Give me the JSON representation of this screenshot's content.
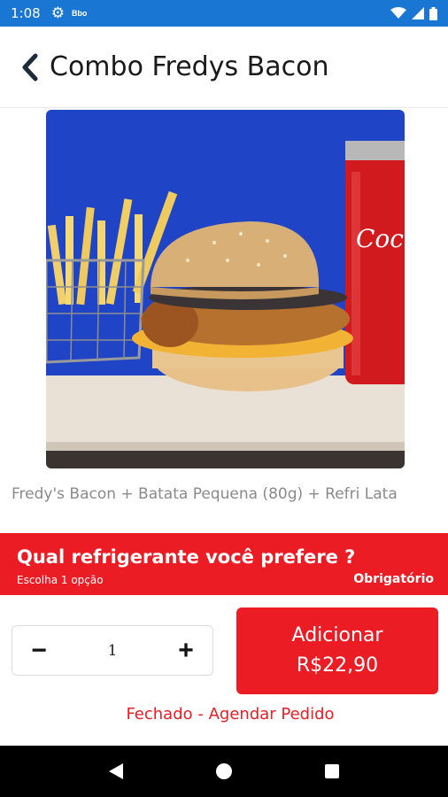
{
  "status_bar": {
    "time": "1:08",
    "app_badge": "Bbo",
    "icons": [
      "settings-icon",
      "wifi-icon",
      "signal-icon",
      "battery-icon"
    ],
    "color": "#1976d2"
  },
  "header": {
    "title": "Combo Fredys Bacon",
    "back_icon": "chevron-left-icon"
  },
  "product": {
    "image": "burger-combo-photo",
    "description": "Fredy's Bacon + Batata Pequena (80g) + Refri Lata"
  },
  "question": {
    "text": "Qual refrigerante você prefere ?",
    "subtext": "Escolha 1 opção",
    "required_label": "Obrigatório",
    "color": "#ec1c24"
  },
  "quantity": {
    "minus": "−",
    "value": "1",
    "plus": "+"
  },
  "add_button": {
    "label": "Adicionar",
    "price": "R$22,90"
  },
  "status_link": "Fechado - Agendar Pedido",
  "nav": {
    "back_icon": "nav-back-icon",
    "home_icon": "nav-home-icon",
    "recents_icon": "nav-recents-icon"
  }
}
